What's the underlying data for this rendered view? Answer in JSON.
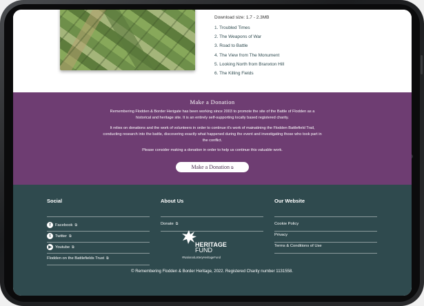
{
  "downloads": {
    "size_text": "Download size: 1.7 - 2.3MB",
    "tracks": [
      "1. Troubled Times",
      "2. The Weapons of War",
      "3. Road to Battle",
      "4. The View from The Monument",
      "5. Looking North from Branxton Hill",
      "6. The Killing Fields"
    ]
  },
  "donation": {
    "title": "Make a Donation",
    "para1": "Remembering Flodden & Border Herigate has been working since 2003 to promote the site of the Battle of Flodden as a historical and heritage site. It is an entirely self-supporting locally based registered charity.",
    "para2": "It relies on donations and the work of volunteers in order to continue it's work of mainatining the Flodden Battlefield Trail, conducting research into the battle, discovering exactly what happened during the event and investigating those who took part in the conflict.",
    "para3": "Please consider making a donation in order to help us continue this valuable work.",
    "button": "Make a Donation",
    "bg_color": "#6e3d72"
  },
  "footer": {
    "bg_color": "#2f4a4e",
    "social": {
      "title": "Social",
      "facebook": "Facebook",
      "twitter": "Twitter",
      "youtube": "Youtube",
      "trust": "Flodden on the Battlefields Trust"
    },
    "about": {
      "title": "About Us",
      "donate": "Donate"
    },
    "website": {
      "title": "Our Website",
      "cookie": "Cookie Policy",
      "privacy": "Privacy",
      "terms": "Terms & Conditions of Use"
    },
    "logo": {
      "line1": "HERITAGE",
      "line2": "FUND",
      "tagline": "#NationalLotteryHeritageFund"
    },
    "copyright": "© Remembering Flodden & Border Heritage, 2022. Registered Charity number 1131558."
  }
}
